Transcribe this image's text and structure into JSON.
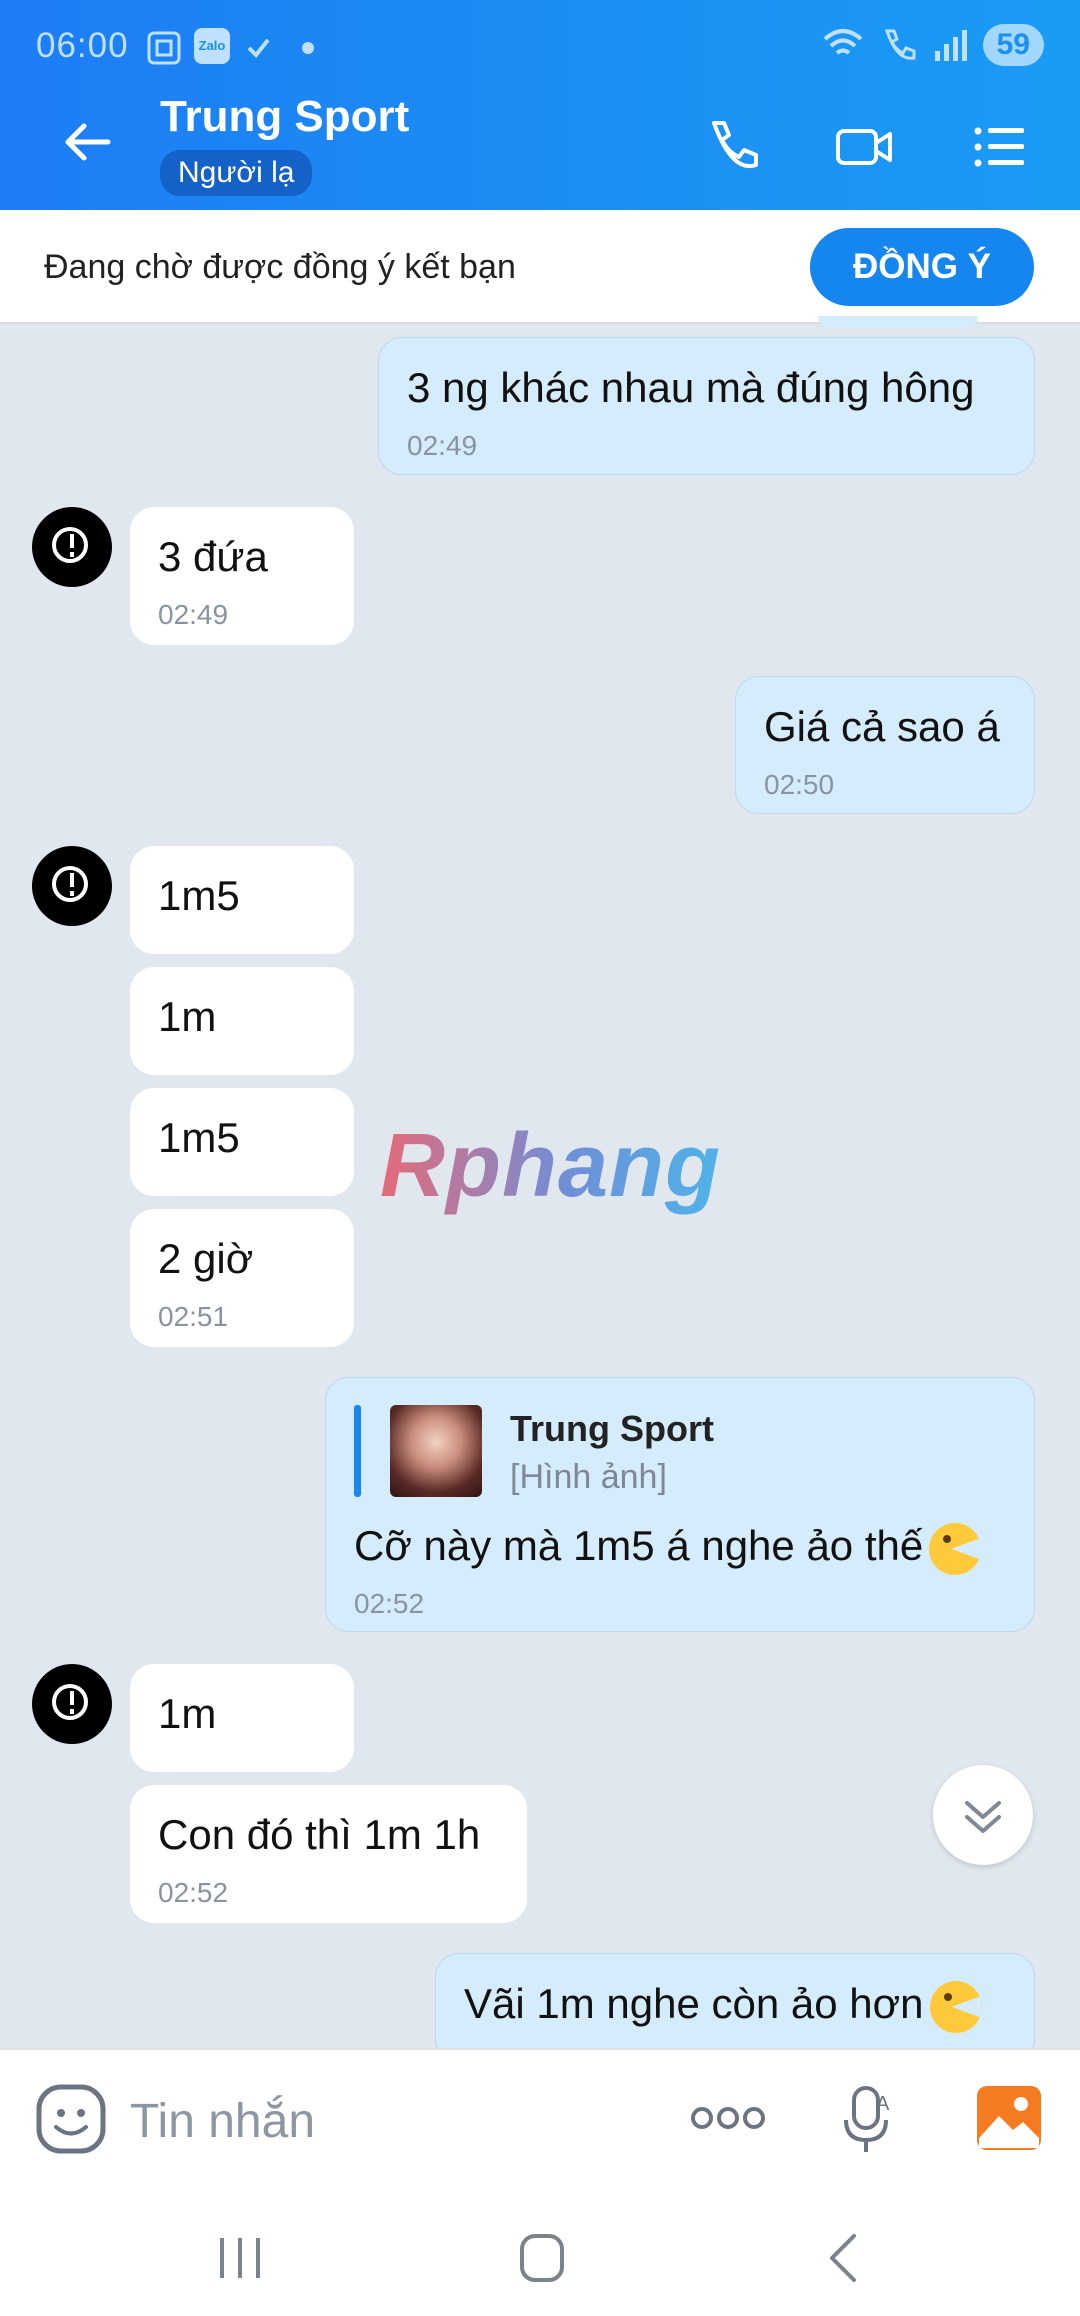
{
  "status": {
    "time": "06:00",
    "battery": "59",
    "app_badge": "Zalo"
  },
  "header": {
    "title": "Trung Sport",
    "chip": "Người lạ"
  },
  "friend_request": {
    "text": "Đang chờ được đồng ý kết bạn",
    "button": "ĐỒNG Ý"
  },
  "messages": [
    {
      "dir": "out",
      "text": "3 ng khác nhau mà đúng hông",
      "time": "02:49"
    },
    {
      "dir": "in",
      "text": "3 đứa",
      "time": "02:49"
    },
    {
      "dir": "out",
      "text": "Giá cả sao á",
      "time": "02:50"
    },
    {
      "dir": "in",
      "text": "1m5"
    },
    {
      "dir": "in",
      "text": "1m"
    },
    {
      "dir": "in",
      "text": "1m5"
    },
    {
      "dir": "in",
      "text": "2 giờ",
      "time": "02:51"
    },
    {
      "dir": "out",
      "reply_name": "Trung Sport",
      "reply_type": "[Hình ảnh]",
      "text": "Cỡ này mà 1m5 á nghe ảo thế",
      "time": "02:52"
    },
    {
      "dir": "in",
      "text": "1m"
    },
    {
      "dir": "in",
      "text": "Con đó thì 1m 1h",
      "time": "02:52"
    },
    {
      "dir": "out",
      "text": "Vãi 1m nghe còn ảo hơn"
    }
  ],
  "watermark": "Rphang",
  "input": {
    "placeholder": "Tin nhắn"
  }
}
